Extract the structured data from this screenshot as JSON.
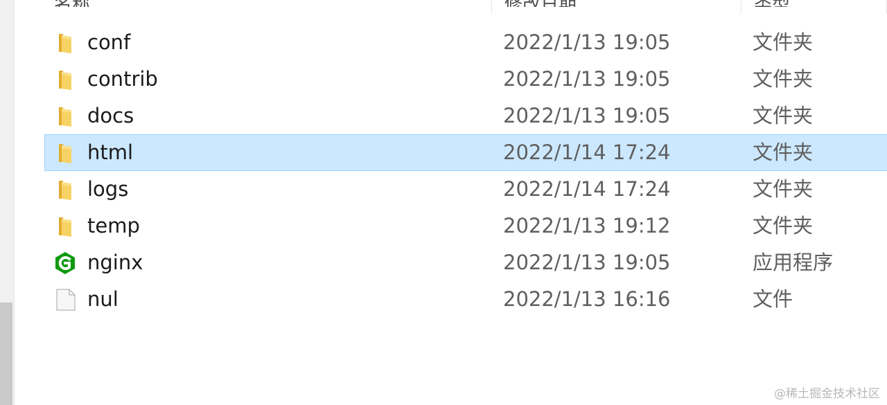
{
  "header": {
    "columns": [
      {
        "label": "名称"
      },
      {
        "label": "修改日期"
      },
      {
        "label": "类型"
      }
    ]
  },
  "files": [
    {
      "name": "conf",
      "date": "2022/1/13 19:05",
      "type": "文件夹",
      "icon": "folder-icon",
      "selected": false
    },
    {
      "name": "contrib",
      "date": "2022/1/13 19:05",
      "type": "文件夹",
      "icon": "folder-icon",
      "selected": false
    },
    {
      "name": "docs",
      "date": "2022/1/13 19:05",
      "type": "文件夹",
      "icon": "folder-icon",
      "selected": false
    },
    {
      "name": "html",
      "date": "2022/1/14 17:24",
      "type": "文件夹",
      "icon": "folder-icon",
      "selected": true
    },
    {
      "name": "logs",
      "date": "2022/1/14 17:24",
      "type": "文件夹",
      "icon": "folder-icon",
      "selected": false
    },
    {
      "name": "temp",
      "date": "2022/1/13 19:12",
      "type": "文件夹",
      "icon": "folder-icon",
      "selected": false
    },
    {
      "name": "nginx",
      "date": "2022/1/13 19:05",
      "type": "应用程序",
      "icon": "nginx-app-icon",
      "selected": false
    },
    {
      "name": "nul",
      "date": "2022/1/13 16:16",
      "type": "文件",
      "icon": "blank-file-icon",
      "selected": false
    }
  ],
  "watermark": "@稀土掘金技术社区",
  "colors": {
    "selection_bg": "#cce8ff",
    "selection_border": "#99d1ff",
    "folder": "#f4c54a",
    "nginx_green": "#0e9a0e"
  }
}
